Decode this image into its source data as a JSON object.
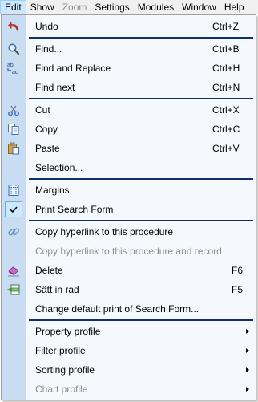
{
  "menubar": {
    "items": [
      {
        "label": "Edit",
        "active": true
      },
      {
        "label": "Show"
      },
      {
        "label": "Zoom",
        "disabled": true
      },
      {
        "label": "Settings"
      },
      {
        "label": "Modules"
      },
      {
        "label": "Window"
      },
      {
        "label": "Help"
      }
    ]
  },
  "menu": {
    "undo": {
      "label": "Undo",
      "shortcut": "Ctrl+Z",
      "icon": "undo-icon"
    },
    "find": {
      "label": "Find...",
      "shortcut": "Ctrl+B",
      "icon": "search-icon"
    },
    "find_replace": {
      "label": "Find and Replace",
      "shortcut": "Ctrl+H",
      "icon": "replace-icon"
    },
    "find_next": {
      "label": "Find next",
      "shortcut": "Ctrl+N"
    },
    "cut": {
      "label": "Cut",
      "shortcut": "Ctrl+X",
      "icon": "scissors-icon"
    },
    "copy": {
      "label": "Copy",
      "shortcut": "Ctrl+C",
      "icon": "copy-icon"
    },
    "paste": {
      "label": "Paste",
      "shortcut": "Ctrl+V",
      "icon": "paste-icon"
    },
    "selection": {
      "label": "Selection..."
    },
    "margins": {
      "label": "Margins",
      "icon": "margins-icon"
    },
    "print_search_form": {
      "label": "Print Search Form",
      "checked": true,
      "icon": "checkmark-icon"
    },
    "copy_hyperlink": {
      "label": "Copy hyperlink to this procedure",
      "icon": "link-icon"
    },
    "copy_hyperlink_record": {
      "label": "Copy hyperlink to this procedure and record",
      "disabled": true
    },
    "delete": {
      "label": "Delete",
      "shortcut": "F6",
      "icon": "eraser-icon"
    },
    "insert_row": {
      "label": "Sätt in rad",
      "shortcut": "F5",
      "icon": "insert-row-icon"
    },
    "change_default_print": {
      "label": "Change default print of Search Form..."
    },
    "property_profile": {
      "label": "Property profile"
    },
    "filter_profile": {
      "label": "Filter profile"
    },
    "sorting_profile": {
      "label": "Sorting profile"
    },
    "chart_profile": {
      "label": "Chart profile",
      "disabled": true
    }
  },
  "colors": {
    "gutter": "#c9ddf2",
    "menu_bg": "#f5f9fe",
    "separator": "#102f6e",
    "active_menubar": "#cce8ff",
    "disabled_text": "#8d8d8d"
  }
}
